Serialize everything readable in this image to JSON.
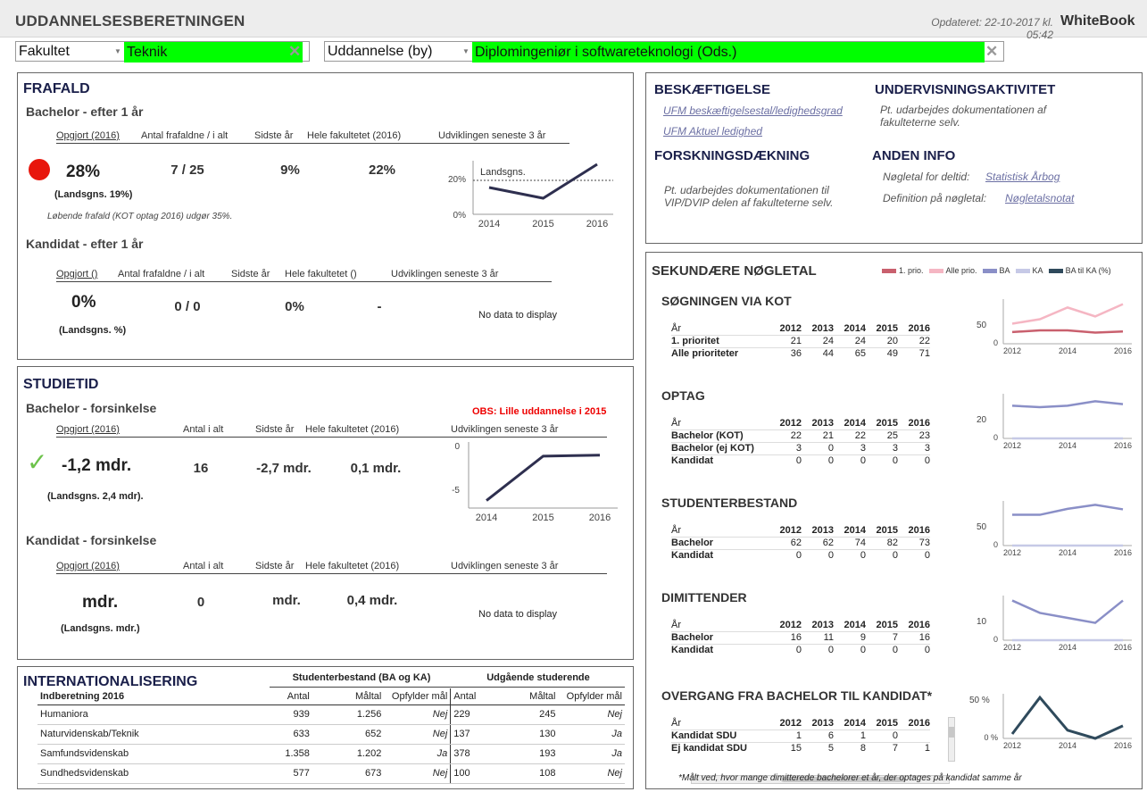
{
  "header": {
    "title": "UDDANNELSESBERETNINGEN",
    "updated": "Opdateret: 22-10-2017 kl. 05:42",
    "brand": "WhiteBook"
  },
  "filters": {
    "fakultet_label": "Fakultet",
    "fakultet_value": "Teknik",
    "uddannelse_label": "Uddannelse (by)",
    "uddannelse_value": "Diplomingeniør i softwareteknologi (Ods.)"
  },
  "frafald": {
    "title": "FRAFALD",
    "bachelor": {
      "subtitle": "Bachelor - efter 1 år",
      "headers": [
        "Opgjort (2016)",
        "Antal frafaldne / i alt",
        "Sidste år",
        "Hele fakultetet  (2016)",
        "Udviklingen seneste 3 år"
      ],
      "value": "28%",
      "count": "7 / 25",
      "last": "9%",
      "faculty": "22%",
      "national": "(Landsgns. 19%)",
      "note": "Løbende frafald (KOT optag 2016) udgør 35%."
    },
    "kandidat": {
      "subtitle": "Kandidat - efter 1 år",
      "headers": [
        "Opgjort ()",
        "Antal frafaldne / i alt",
        "Sidste år",
        "Hele fakultetet  ()",
        "Udviklingen seneste 3 år"
      ],
      "value": "0%",
      "count": "0 / 0",
      "last": "0%",
      "faculty": "-",
      "national": "(Landsgns. %)",
      "nodata": "No data to display"
    }
  },
  "studietid": {
    "title": "STUDIETID",
    "warning": "OBS: Lille uddannelse i 2015",
    "bachelor": {
      "subtitle": "Bachelor - forsinkelse",
      "headers": [
        "Opgjort (2016)",
        "Antal i alt",
        "Sidste år",
        "Hele fakultetet  (2016)",
        "Udviklingen seneste 3 år"
      ],
      "value": "-1,2 mdr.",
      "count": "16",
      "last": "-2,7 mdr.",
      "faculty": "0,1 mdr.",
      "national": "(Landsgns. 2,4 mdr)."
    },
    "kandidat": {
      "subtitle": "Kandidat - forsinkelse",
      "headers": [
        "Opgjort (2016)",
        "Antal i alt",
        "Sidste år",
        "Hele fakultetet  (2016)",
        "Udviklingen seneste 3 år"
      ],
      "value": "mdr.",
      "count": "0",
      "last": "mdr.",
      "faculty": "0,4 mdr.",
      "national": "(Landsgns.  mdr.)",
      "nodata": "No data to display"
    }
  },
  "intl": {
    "title": "INTERNATIONALISERING",
    "group1": "Studenterbestand (BA og KA)",
    "group2": "Udgående studerende",
    "cols": [
      "Indberetning 2016",
      "Antal",
      "Måltal",
      "Opfylder mål",
      "Antal",
      "Måltal",
      "Opfylder mål"
    ],
    "rows": [
      [
        "Humaniora",
        "939",
        "1.256",
        "Nej",
        "229",
        "245",
        "Nej"
      ],
      [
        "Naturvidenskab/Teknik",
        "633",
        "652",
        "Nej",
        "137",
        "130",
        "Ja"
      ],
      [
        "Samfundsvidenskab",
        "1.358",
        "1.202",
        "Ja",
        "378",
        "193",
        "Ja"
      ],
      [
        "Sundhedsvidenskab",
        "577",
        "673",
        "Nej",
        "100",
        "108",
        "Nej"
      ]
    ]
  },
  "info": {
    "besk_title": "BESKÆFTIGELSE",
    "besk_link1": "UFM beskæftigelsestal/ledighedsgrad",
    "besk_link2": "UFM Aktuel ledighed",
    "und_title": "UNDERVISNINGSAKTIVITET",
    "und_text": "Pt. udarbejdes dokumentationen af fakulteterne selv.",
    "forsk_title": "FORSKNINGSDÆKNING",
    "forsk_text": "Pt. udarbejdes dokumentationen til VIP/DVIP delen af fakulteterne selv.",
    "anden_title": "ANDEN INFO",
    "anden_l1": "Nøgletal for deltid:",
    "anden_link1": "Statistisk Årbog",
    "anden_l2": "Definition på nøgletal:",
    "anden_link2": "Nøgletalsnotat"
  },
  "sek": {
    "title": "SEKUNDÆRE NØGLETAL",
    "legend": [
      {
        "label": "1. prio.",
        "color": "#c9606e"
      },
      {
        "label": "Alle prio.",
        "color": "#f5b6c3"
      },
      {
        "label": "BA",
        "color": "#8a8fc7"
      },
      {
        "label": "KA",
        "color": "#c6c9e6"
      },
      {
        "label": "BA til KA (%)",
        "color": "#2f4a5c"
      }
    ],
    "years": [
      "År",
      "2012",
      "2013",
      "2014",
      "2015",
      "2016"
    ],
    "sections": [
      {
        "title": "SØGNINGEN VIA KOT",
        "rows": [
          [
            "1. prioritet",
            "21",
            "24",
            "24",
            "20",
            "22"
          ],
          [
            "Alle prioriteter",
            "36",
            "44",
            "65",
            "49",
            "71"
          ]
        ],
        "ytick": "50"
      },
      {
        "title": "OPTAG",
        "rows": [
          [
            "Bachelor (KOT)",
            "22",
            "21",
            "22",
            "25",
            "23"
          ],
          [
            "Bachelor (ej KOT)",
            "3",
            "0",
            "3",
            "3",
            "3"
          ],
          [
            "Kandidat",
            "0",
            "0",
            "0",
            "0",
            "0"
          ]
        ],
        "ytick": "20"
      },
      {
        "title": "STUDENTERBESTAND",
        "rows": [
          [
            "Bachelor",
            "62",
            "62",
            "74",
            "82",
            "73"
          ],
          [
            "Kandidat",
            "0",
            "0",
            "0",
            "0",
            "0"
          ]
        ],
        "ytick": "50"
      },
      {
        "title": "DIMITTENDER",
        "rows": [
          [
            "Bachelor",
            "16",
            "11",
            "9",
            "7",
            "16"
          ],
          [
            "Kandidat",
            "0",
            "0",
            "0",
            "0",
            "0"
          ]
        ],
        "ytick": "10"
      },
      {
        "title": "OVERGANG FRA BACHELOR TIL KANDIDAT*",
        "rows": [
          [
            "Kandidat SDU",
            "1",
            "6",
            "1",
            "0",
            ""
          ],
          [
            "Ej kandidat SDU",
            "15",
            "5",
            "8",
            "7",
            "1"
          ]
        ],
        "ytick": "50 %"
      }
    ],
    "footnote": "*Målt ved, hvor mange dimitterede bachelorer et år, der optages på kandidat samme år"
  },
  "chart_data": [
    {
      "type": "line",
      "title": "",
      "categories": [
        "2014",
        "2015",
        "2016"
      ],
      "series": [
        {
          "name": "",
          "values": [
            15,
            9,
            28
          ]
        }
      ],
      "reference": {
        "label": "Landsgns.",
        "value": 19
      },
      "ylim": [
        0,
        30
      ],
      "yticks": [
        "0%",
        "20%"
      ]
    },
    {
      "type": "line",
      "title": "",
      "categories": [
        "2014",
        "2015",
        "2016"
      ],
      "series": [
        {
          "name": "",
          "values": [
            -6.2,
            -1.5,
            -1.4
          ]
        }
      ],
      "ylim": [
        -7,
        0
      ],
      "yticks": [
        "0",
        "-5"
      ]
    },
    {
      "type": "line",
      "categories": [
        "2012",
        "2014",
        "2016"
      ],
      "x": [
        2012,
        2013,
        2014,
        2015,
        2016
      ],
      "series": [
        {
          "name": "1. prio.",
          "values": [
            21,
            24,
            24,
            20,
            22
          ]
        },
        {
          "name": "Alle prio.",
          "values": [
            36,
            44,
            65,
            49,
            71
          ]
        }
      ],
      "ylim": [
        0,
        80
      ]
    },
    {
      "type": "line",
      "categories": [
        "2012",
        "2014",
        "2016"
      ],
      "x": [
        2012,
        2013,
        2014,
        2015,
        2016
      ],
      "series": [
        {
          "name": "BA",
          "values": [
            22,
            21,
            22,
            25,
            23
          ]
        },
        {
          "name": "KA",
          "values": [
            0,
            0,
            0,
            0,
            0
          ]
        }
      ],
      "ylim": [
        0,
        30
      ]
    },
    {
      "type": "line",
      "categories": [
        "2012",
        "2014",
        "2016"
      ],
      "x": [
        2012,
        2013,
        2014,
        2015,
        2016
      ],
      "series": [
        {
          "name": "BA",
          "values": [
            62,
            62,
            74,
            82,
            73
          ]
        },
        {
          "name": "KA",
          "values": [
            0,
            0,
            0,
            0,
            0
          ]
        }
      ],
      "ylim": [
        0,
        90
      ]
    },
    {
      "type": "line",
      "categories": [
        "2012",
        "2014",
        "2016"
      ],
      "x": [
        2012,
        2013,
        2014,
        2015,
        2016
      ],
      "series": [
        {
          "name": "BA",
          "values": [
            16,
            11,
            9,
            7,
            16
          ]
        },
        {
          "name": "KA",
          "values": [
            0,
            0,
            0,
            0,
            0
          ]
        }
      ],
      "ylim": [
        0,
        18
      ]
    },
    {
      "type": "line",
      "categories": [
        "2012",
        "2014",
        "2016"
      ],
      "x": [
        2012,
        2013,
        2014,
        2015,
        2016
      ],
      "series": [
        {
          "name": "BA til KA (%)",
          "values": [
            6,
            55,
            11,
            0,
            17
          ]
        }
      ],
      "ylim": [
        0,
        60
      ]
    }
  ]
}
